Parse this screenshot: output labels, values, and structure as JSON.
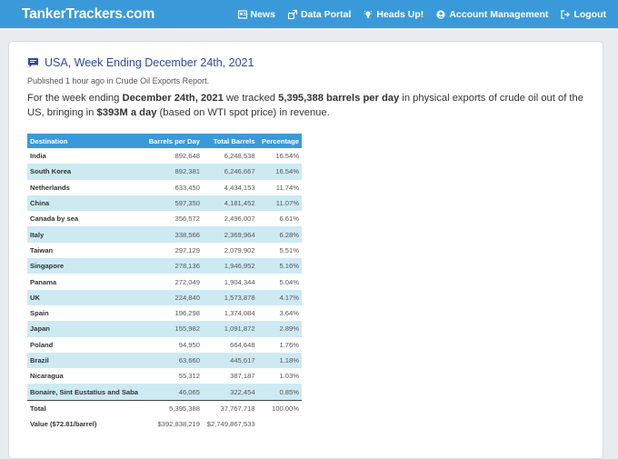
{
  "nav": {
    "brand": "TankerTrackers.com",
    "links": [
      {
        "label": "News",
        "icon": "newspaper-icon"
      },
      {
        "label": "Data Portal",
        "icon": "data-portal-icon"
      },
      {
        "label": "Heads Up!",
        "icon": "lightbulb-icon"
      },
      {
        "label": "Account Management",
        "icon": "user-circle-icon"
      },
      {
        "label": "Logout",
        "icon": "logout-icon"
      }
    ]
  },
  "report": {
    "title": "USA, Week Ending December 24th, 2021",
    "published": "Published 1 hour ago in Crude Oil Exports Report.",
    "summary": {
      "p1": "For the week ending ",
      "week": "December 24th, 2021",
      "p2": " we tracked ",
      "bpd": "5,395,388 barrels per day",
      "p3": " in physical exports of crude oil out of the US, bringing in ",
      "revenue": "$393M a day",
      "p4": " (based on WTI spot price) in revenue."
    }
  },
  "table": {
    "headers": [
      "Destination",
      "Barrels per Day",
      "Total Barrels",
      "Percentage"
    ],
    "rows": [
      [
        "India",
        "892,648",
        "6,248,538",
        "16.54%"
      ],
      [
        "South Korea",
        "892,381",
        "6,246,667",
        "16.54%"
      ],
      [
        "Netherlands",
        "633,450",
        "4,434,153",
        "11.74%"
      ],
      [
        "China",
        "597,350",
        "4,181,452",
        "11.07%"
      ],
      [
        "Canada by sea",
        "356,572",
        "2,496,007",
        "6.61%"
      ],
      [
        "Italy",
        "338,566",
        "2,369,964",
        "6.28%"
      ],
      [
        "Taiwan",
        "297,129",
        "2,079,902",
        "5.51%"
      ],
      [
        "Singapore",
        "278,136",
        "1,946,952",
        "5.16%"
      ],
      [
        "Panama",
        "272,049",
        "1,904,344",
        "5.04%"
      ],
      [
        "UK",
        "224,840",
        "1,573,878",
        "4.17%"
      ],
      [
        "Spain",
        "196,298",
        "1,374,084",
        "3.64%"
      ],
      [
        "Japan",
        "155,982",
        "1,091,872",
        "2.89%"
      ],
      [
        "Poland",
        "94,950",
        "664,648",
        "1.76%"
      ],
      [
        "Brazil",
        "63,660",
        "445,617",
        "1.18%"
      ],
      [
        "Nicaragua",
        "55,312",
        "387,187",
        "1.03%"
      ],
      [
        "Bonaire, Sint Eustatius and Saba",
        "46,065",
        "322,454",
        "0.85%"
      ]
    ],
    "total": [
      "Total",
      "5,395,388",
      "37,767,718",
      "100.00%"
    ],
    "value": [
      "Value ($72.81/barrel)",
      "$392,838,219",
      "$2,749,867,533",
      ""
    ]
  },
  "colors": {
    "navbar": "#3a9ad9",
    "header": "#3a9ad9",
    "stripe": "#cdeaf3",
    "title": "#2e4a9e"
  }
}
